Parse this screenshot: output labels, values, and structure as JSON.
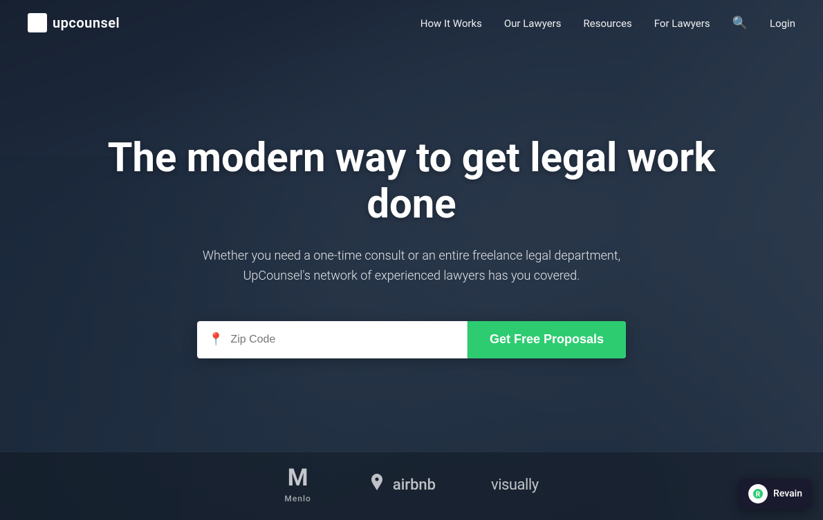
{
  "nav": {
    "logo_text": "upcounsel",
    "logo_icon": "📄",
    "links": [
      {
        "id": "how-it-works",
        "label": "How It Works"
      },
      {
        "id": "our-lawyers",
        "label": "Our Lawyers"
      },
      {
        "id": "resources",
        "label": "Resources"
      },
      {
        "id": "for-lawyers",
        "label": "For Lawyers"
      }
    ],
    "login_label": "Login"
  },
  "hero": {
    "title": "The modern way to get legal work done",
    "subtitle": "Whether you need a one-time consult or an entire freelance legal department, UpCounsel's network of experienced lawyers has you covered.",
    "search_placeholder": "Zip Code",
    "cta_label": "Get Free Proposals"
  },
  "brands": [
    {
      "id": "menlo",
      "name": "Menlo",
      "letter": "M"
    },
    {
      "id": "airbnb",
      "name": "airbnb",
      "symbol": "⬡"
    },
    {
      "id": "visually",
      "name": "visually"
    }
  ],
  "revain": {
    "label": "Revain"
  }
}
